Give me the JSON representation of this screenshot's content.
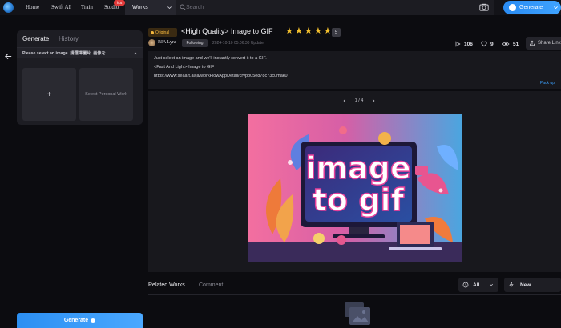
{
  "topnav": {
    "items": [
      {
        "label": "Home"
      },
      {
        "label": "Swift AI"
      },
      {
        "label": "Train"
      },
      {
        "label": "Studio"
      }
    ],
    "hot_badge": "hot",
    "works_select": "Works",
    "search_placeholder": "Search",
    "generate_label": "Generate"
  },
  "left": {
    "tabs": {
      "generate": "Generate",
      "history": "History"
    },
    "panel_head": "Please select an image. 請選擇圖片. 画像を...",
    "upload_label": "+",
    "personal_label": "Select Personal Work",
    "generate_label": "Generate"
  },
  "header": {
    "badge": "Original",
    "title": "<High Quality> Image to GIF",
    "stars": [
      "★",
      "★",
      "★",
      "★",
      "★"
    ],
    "rating": "5",
    "author": "RIA Lyra",
    "follow": "Following",
    "timestamp": "2024-10-10 05:06:30 Update",
    "stats": {
      "runs": "106",
      "likes": "9",
      "views": "51"
    },
    "share": "Share Link"
  },
  "description": {
    "line1": "Just select an image and we'll instantly convert it to a GIF.",
    "line2": "<Fast And Light> Image to GIF",
    "line3": "https://www.seaart.ai/ja/workFlowAppDetail/crvpo05e878c73cumak0",
    "packup": "Pack up"
  },
  "media": {
    "pager": "1 / 4",
    "image_text_line1": "image",
    "image_text_line2": "to gif"
  },
  "related": {
    "tabs": {
      "works": "Related Works",
      "comment": "Comment"
    },
    "filter_all": "All",
    "filter_new": "New"
  },
  "colors": {
    "accent": "#2e95f5",
    "star": "#f6c22e",
    "original_badge": "#f5b83d"
  }
}
